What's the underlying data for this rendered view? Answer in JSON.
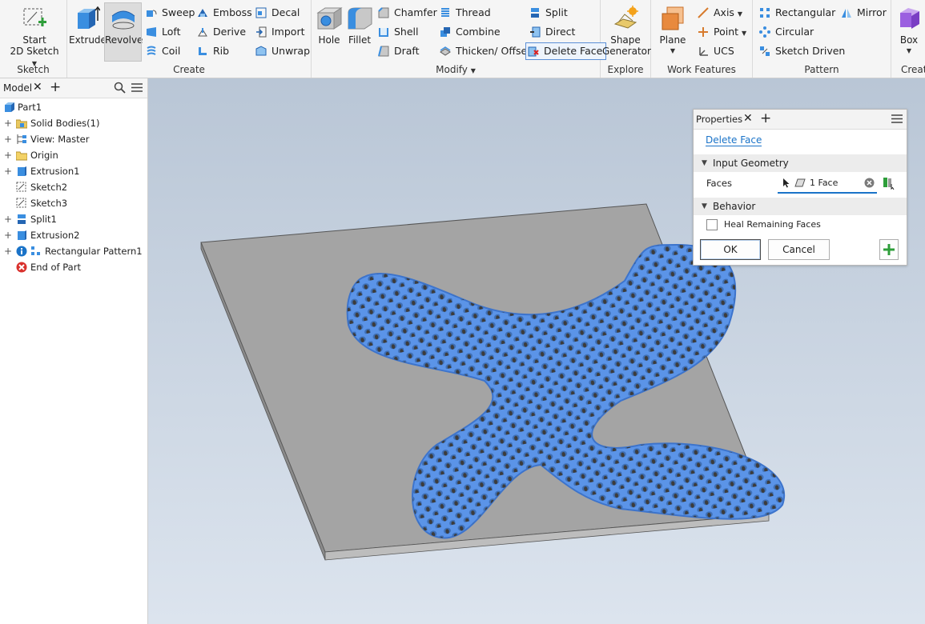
{
  "ribbon": {
    "sketch": {
      "group_label": "Sketch",
      "start_line1": "Start",
      "start_line2": "2D Sketch"
    },
    "create": {
      "group_label": "Create",
      "extrude": "Extrude",
      "revolve": "Revolve",
      "sweep": "Sweep",
      "loft": "Loft",
      "coil": "Coil",
      "emboss": "Emboss",
      "derive": "Derive",
      "rib": "Rib",
      "decal": "Decal",
      "import": "Import",
      "unwrap": "Unwrap"
    },
    "modify": {
      "group_label": "Modify",
      "hole": "Hole",
      "fillet": "Fillet",
      "chamfer": "Chamfer",
      "shell": "Shell",
      "draft": "Draft",
      "thread": "Thread",
      "combine": "Combine",
      "thicken": "Thicken/ Offset",
      "split": "Split",
      "direct": "Direct",
      "delete_face": "Delete Face"
    },
    "explore": {
      "group_label": "Explore",
      "shape_line1": "Shape",
      "shape_line2": "Generator"
    },
    "work_features": {
      "group_label": "Work Features",
      "plane": "Plane",
      "axis": "Axis",
      "point": "Point",
      "ucs": "UCS"
    },
    "pattern": {
      "group_label": "Pattern",
      "rectangular": "Rectangular",
      "circular": "Circular",
      "sketch_driven": "Sketch Driven",
      "mirror": "Mirror"
    },
    "cut": {
      "group_label": "Creat",
      "box": "Box"
    }
  },
  "browser": {
    "tab_label": "Model",
    "items": [
      {
        "label": "Part1"
      },
      {
        "label": "Solid Bodies(1)"
      },
      {
        "label": "View: Master"
      },
      {
        "label": "Origin"
      },
      {
        "label": "Extrusion1"
      },
      {
        "label": "Sketch2"
      },
      {
        "label": "Sketch3"
      },
      {
        "label": "Split1"
      },
      {
        "label": "Extrusion2"
      },
      {
        "label": "Rectangular Pattern1"
      },
      {
        "label": "End of Part"
      }
    ]
  },
  "properties": {
    "tab_label": "Properties",
    "command_title": "Delete Face",
    "input_geometry_label": "Input Geometry",
    "faces_label": "Faces",
    "faces_value": "1 Face",
    "behavior_label": "Behavior",
    "heal_label": "Heal Remaining Faces",
    "heal_checked": false,
    "ok_label": "OK",
    "cancel_label": "Cancel"
  },
  "colors": {
    "accent": "#1a73c8",
    "highlight_face": "#5b94e8",
    "plate": "#a4a4a4",
    "add_green": "#2e9e3a"
  }
}
